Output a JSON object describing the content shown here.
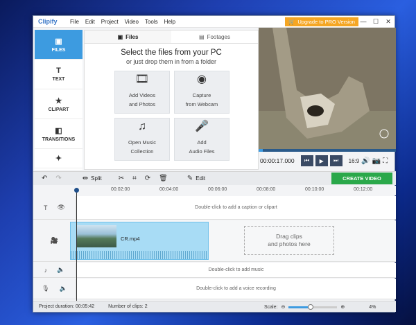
{
  "app": {
    "logo": "Clipify",
    "upgrade": "Upgrade to PRO Version"
  },
  "menu": [
    "File",
    "Edit",
    "Project",
    "Video",
    "Tools",
    "Help"
  ],
  "sidebar": [
    {
      "label": "FILES",
      "icon": "image-icon",
      "glyph": "▣"
    },
    {
      "label": "TEXT",
      "icon": "text-icon",
      "glyph": "T"
    },
    {
      "label": "CLIPART",
      "icon": "star-icon",
      "glyph": "★"
    },
    {
      "label": "TRANSITIONS",
      "icon": "transitions-icon",
      "glyph": "◧"
    },
    {
      "label": "",
      "icon": "magic-wand-icon",
      "glyph": "✦"
    }
  ],
  "tabs": {
    "files": "Files",
    "footages": "Footages"
  },
  "files": {
    "headline": "Select the files from your PC",
    "subline": "or just drop them in from a folder",
    "tiles": [
      {
        "l1": "Add Videos",
        "l2": "and Photos",
        "icon": "film-icon",
        "glyph": "🎞"
      },
      {
        "l1": "Capture",
        "l2": "from Webcam",
        "icon": "webcam-icon",
        "glyph": "◉"
      },
      {
        "l1": "Open Music",
        "l2": "Collection",
        "icon": "music-icon",
        "glyph": "♫"
      },
      {
        "l1": "Add",
        "l2": "Audio Files",
        "icon": "microphone-icon",
        "glyph": "🎤"
      }
    ]
  },
  "player": {
    "time": "00:00:17.000",
    "ratio": "16:9",
    "progress": 0.03
  },
  "toolbar": {
    "split": "Split",
    "edit": "Edit",
    "create": "CREATE VIDEO"
  },
  "ruler": [
    "00:02:00",
    "00:04:00",
    "00:06:00",
    "00:08:00",
    "00:10:00",
    "00:12:00"
  ],
  "tracks": {
    "caption": "Double-click to add a caption or clipart",
    "music": "Double-click to add music",
    "voice": "Double-click to add a voice recording"
  },
  "clip": {
    "name": "CR.mp4"
  },
  "drop": {
    "l1": "Drag clips",
    "l2": "and photos here"
  },
  "status": {
    "duration": "Project duration:  00:05:42",
    "clips": "Number of clips: 2",
    "scale": "Scale:",
    "percent": "4%",
    "scale_level": 0.45
  }
}
